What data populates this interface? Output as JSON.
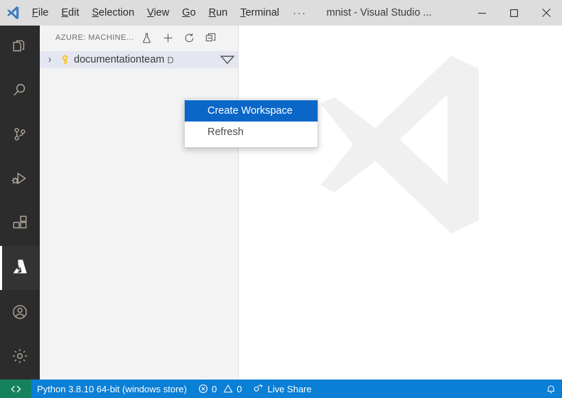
{
  "titlebar": {
    "logo_icon": "vscode-logo-icon",
    "menus": [
      {
        "label": "File",
        "mnemonic": "F"
      },
      {
        "label": "Edit",
        "mnemonic": "E"
      },
      {
        "label": "Selection",
        "mnemonic": "S"
      },
      {
        "label": "View",
        "mnemonic": "V"
      },
      {
        "label": "Go",
        "mnemonic": "G"
      },
      {
        "label": "Run",
        "mnemonic": "R"
      },
      {
        "label": "Terminal",
        "mnemonic": "T"
      }
    ],
    "overflow_label": "···",
    "window_title": "mnist - Visual Studio ...",
    "minimize_label": "—",
    "maximize_label": "□",
    "close_label": "✕"
  },
  "activitybar": {
    "items": [
      {
        "name": "explorer",
        "icon": "files-icon",
        "active": false
      },
      {
        "name": "search",
        "icon": "search-icon",
        "active": false
      },
      {
        "name": "source-control",
        "icon": "source-control-icon",
        "active": false
      },
      {
        "name": "run-and-debug",
        "icon": "run-debug-icon",
        "active": false
      },
      {
        "name": "extensions",
        "icon": "extensions-icon",
        "active": false
      },
      {
        "name": "azure",
        "icon": "azure-icon",
        "active": true
      }
    ],
    "bottom_items": [
      {
        "name": "accounts",
        "icon": "account-icon"
      },
      {
        "name": "manage",
        "icon": "gear-icon"
      }
    ]
  },
  "sidebar": {
    "title": "AZURE: MACHINE...",
    "actions": [
      {
        "name": "create-experiment",
        "icon": "flask-icon"
      },
      {
        "name": "add",
        "icon": "plus-icon"
      },
      {
        "name": "refresh",
        "icon": "refresh-icon"
      },
      {
        "name": "split-view",
        "icon": "split-editor-icon"
      }
    ],
    "tree": [
      {
        "label": "documentationteam",
        "icon": "key-icon",
        "chevron": "›",
        "trailing": "D",
        "expanded": false,
        "selected": true,
        "caret_icon": "triangle-down-icon"
      }
    ]
  },
  "editor": {
    "watermark_icon": "vscode-watermark-logo"
  },
  "context_menu": {
    "items": [
      {
        "label": "Create Workspace",
        "selected": true
      },
      {
        "label": "Refresh",
        "selected": false
      }
    ]
  },
  "statusbar": {
    "remote_icon": "remote-indicator-icon",
    "python_version": "Python 3.8.10 64-bit (windows store)",
    "errors_icon": "error-icon",
    "errors_count": "0",
    "warnings_icon": "warning-icon",
    "warnings_count": "0",
    "live_share_icon": "live-share-icon",
    "live_share_label": "Live Share",
    "notifications_icon": "bell-icon"
  },
  "colors": {
    "titlebar_bg": "#dddddd",
    "activitybar_bg": "#2c2c2c",
    "sidebar_bg": "#f3f3f3",
    "statusbar_bg": "#0a7fd6",
    "remote_bg": "#16825d",
    "menu_selected_bg": "#0a67c7",
    "tree_selected_bg": "#e4e6f1",
    "key_icon_color": "#ffc107",
    "watermark_color": "#f0f0f0"
  }
}
